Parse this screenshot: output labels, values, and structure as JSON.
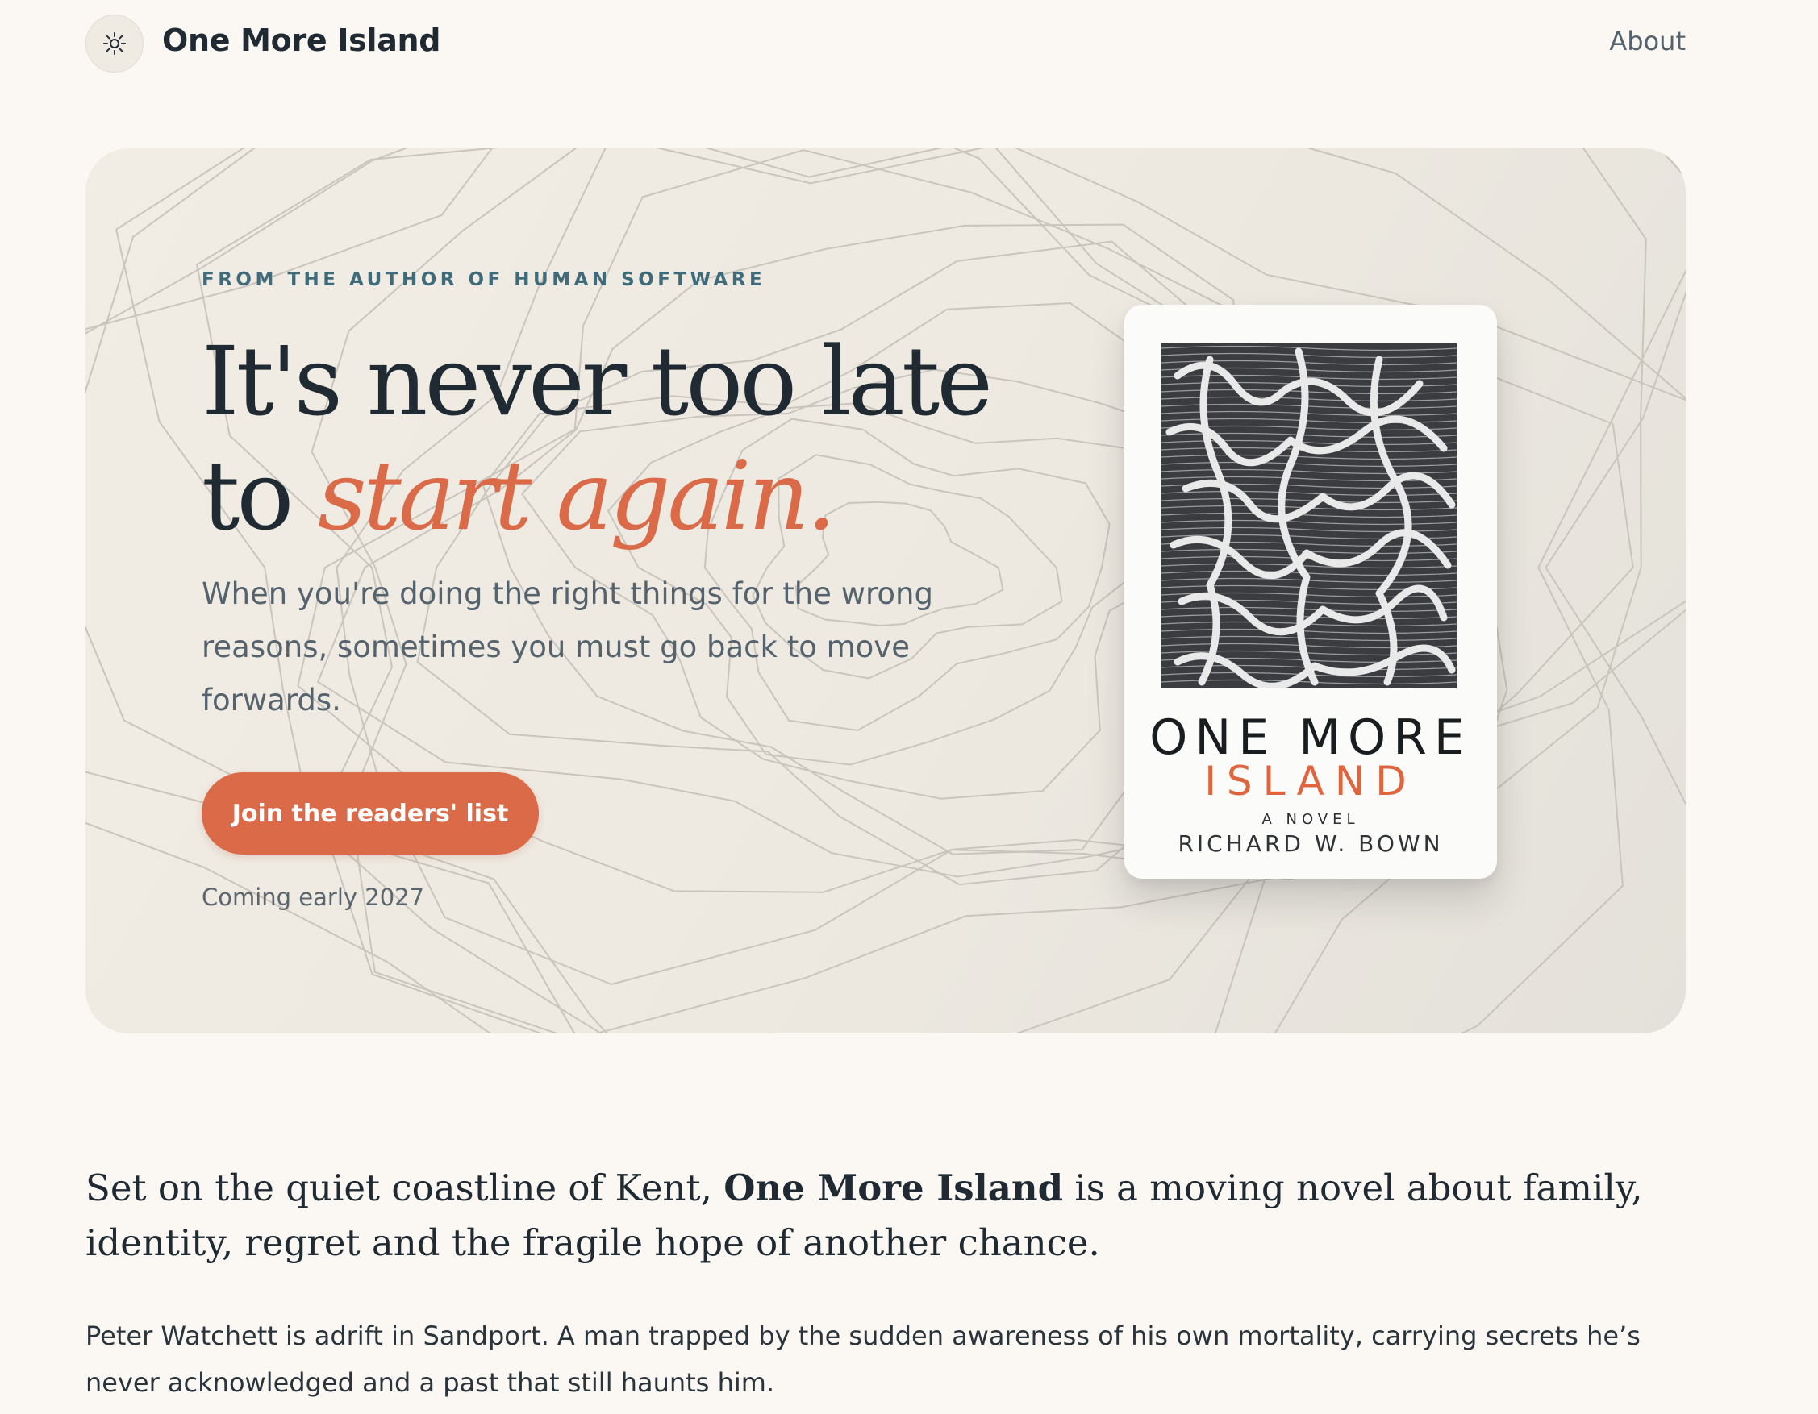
{
  "header": {
    "brand": "One More Island",
    "logo_icon": "sun-icon",
    "nav": {
      "about": "About"
    }
  },
  "hero": {
    "eyebrow": "FROM THE AUTHOR OF HUMAN SOFTWARE",
    "headline_line1": "It's never too late",
    "headline_line2_prefix": "to ",
    "headline_line2_accent": "start again.",
    "lede": "When you're doing the right things for the wrong reasons, sometimes you must go back to move forwards.",
    "cta_label": "Join the readers' list",
    "release_note": "Coming early 2027",
    "background_motif": "topographic-contours",
    "accent_color": "#db6a48"
  },
  "book": {
    "title_line1": "ONE MORE",
    "title_line2": "ISLAND",
    "subtitle": "A NOVEL",
    "author": "RICHARD W. BOWN",
    "cover_art": "topographic-maze-artwork"
  },
  "intro": {
    "prefix": "Set on the quiet coastline of Kent, ",
    "bold": "One More Island",
    "suffix": " is a moving novel about family, identity, regret and the fragile hope of another chance."
  },
  "body": {
    "paragraph1": "Peter Watchett is adrift in Sandport. A man trapped by the sudden awareness of his own mortality, carrying secrets he’s never acknowledged and a past that still haunts him."
  }
}
